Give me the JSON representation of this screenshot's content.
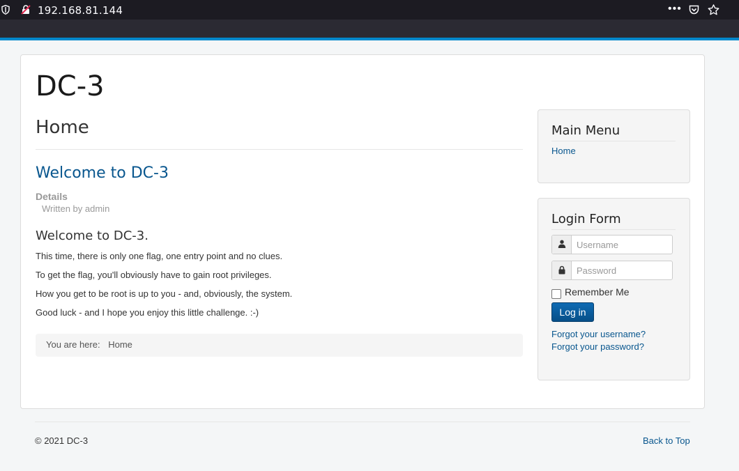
{
  "browser": {
    "url": "192.168.81.144",
    "more_label": "•••"
  },
  "site": {
    "brand": "DC-3",
    "page_heading": "Home",
    "accent_color": "#08568e"
  },
  "article": {
    "title": "Welcome to DC-3",
    "details_label": "Details",
    "author": "Written by admin",
    "subheading": "Welcome to DC-3.",
    "paragraphs": [
      "This time, there is only one flag, one entry point and no clues.",
      "To get the flag, you'll obviously have to gain root privileges.",
      "How you get to be root is up to you - and, obviously, the system.",
      "Good luck - and I hope you enjoy this little challenge.  :-)"
    ]
  },
  "breadcrumb": {
    "prefix": "You are here:",
    "current": "Home"
  },
  "main_menu": {
    "title": "Main Menu",
    "items": [
      {
        "label": "Home"
      }
    ]
  },
  "login_form": {
    "title": "Login Form",
    "username_placeholder": "Username",
    "password_placeholder": "Password",
    "remember_label": "Remember Me",
    "login_button": "Log in",
    "forgot_username": "Forgot your username?",
    "forgot_password": "Forgot your password?"
  },
  "footer": {
    "copyright": "© 2021 DC-3",
    "back_to_top": "Back to Top"
  },
  "icons": {
    "tracking_protection": "shield-icon",
    "connection": "insecure-lock-icon",
    "pocket": "pocket-icon",
    "bookmark": "star-icon",
    "username": "user-icon",
    "password": "lock-icon"
  }
}
